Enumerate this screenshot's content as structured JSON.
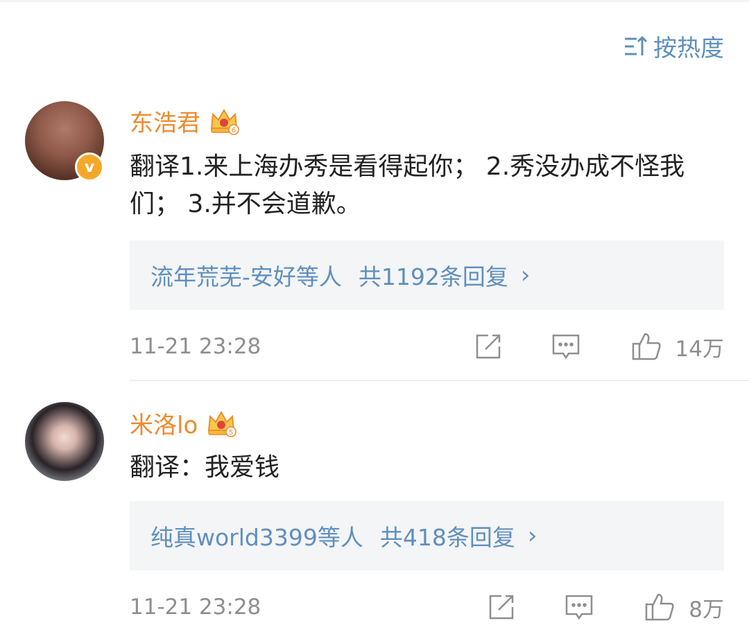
{
  "sort": {
    "label": "按热度"
  },
  "comments": [
    {
      "name": "东浩君",
      "crown_level": "6",
      "verified": "v",
      "text": "翻译1.来上海办秀是看得起你； 2.秀没办成不怪我们； 3.并不会道歉。",
      "replies": {
        "who": "流年荒芜-安好等人",
        "count": "共1192条回复",
        "chev": "›"
      },
      "time": "11-21 23:28",
      "likes": "14万"
    },
    {
      "name": "米洛lo",
      "crown_level": "5",
      "text": "翻译：我爱钱",
      "replies": {
        "who": "纯真world3399等人",
        "count": "共418条回复",
        "chev": "›"
      },
      "time": "11-21 23:28",
      "likes": "8万"
    }
  ],
  "colors": {
    "accent": "#5f8fbd",
    "username": "#f08a2e",
    "muted": "#8e8e8e",
    "reply_bg": "#f4f5f7",
    "badge": "#f4a82a"
  }
}
